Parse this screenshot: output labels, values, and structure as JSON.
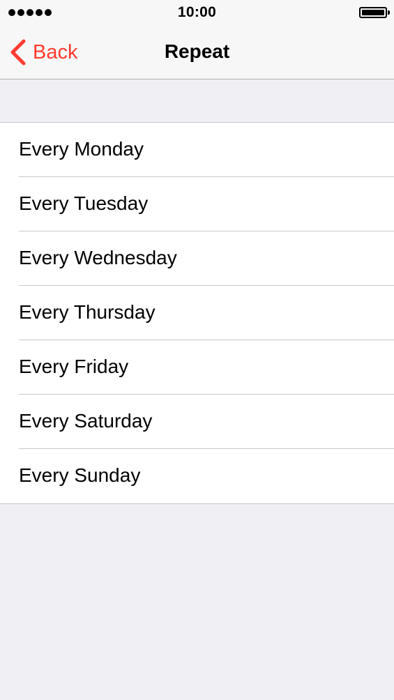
{
  "status_bar": {
    "time": "10:00",
    "signal_icon": "signal-dots-icon",
    "battery_icon": "battery-full-icon",
    "battery_level": 1.0
  },
  "nav": {
    "back_label": "Back",
    "back_icon": "chevron-left-icon",
    "title": "Repeat",
    "accent_color": "#ff3b30"
  },
  "options": [
    {
      "label": "Every Monday"
    },
    {
      "label": "Every Tuesday"
    },
    {
      "label": "Every Wednesday"
    },
    {
      "label": "Every Thursday"
    },
    {
      "label": "Every Friday"
    },
    {
      "label": "Every Saturday"
    },
    {
      "label": "Every Sunday"
    }
  ]
}
